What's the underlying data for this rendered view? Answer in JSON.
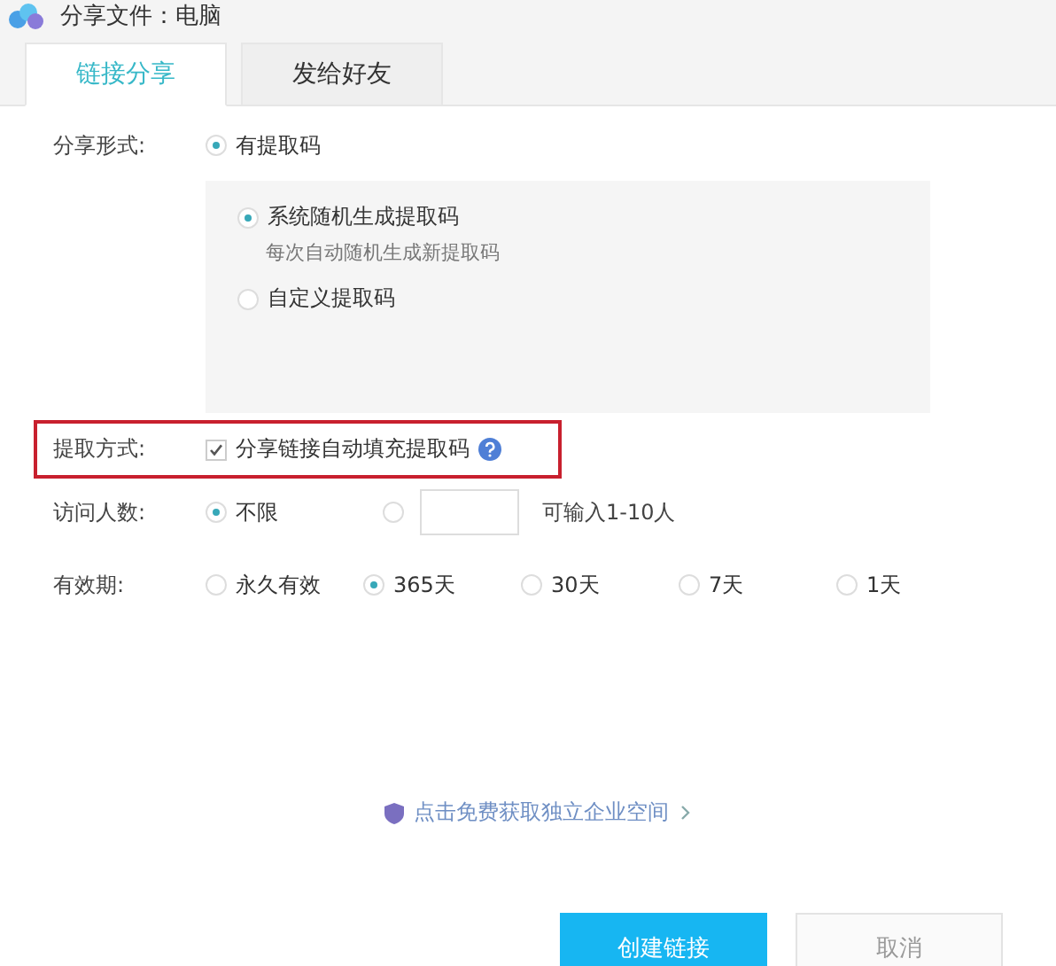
{
  "window": {
    "title": "分享文件：电脑"
  },
  "tabs": [
    {
      "label": "链接分享",
      "selected": true
    },
    {
      "label": "发给好友",
      "selected": false
    }
  ],
  "share_form": {
    "label": "分享形式:",
    "option": {
      "label": "有提取码",
      "selected": true
    },
    "sub_options": [
      {
        "label": "系统随机生成提取码",
        "hint": "每次自动随机生成新提取码",
        "selected": true
      },
      {
        "label": "自定义提取码",
        "selected": false
      }
    ]
  },
  "extract_method": {
    "label": "提取方式:",
    "checkbox": {
      "label": "分享链接自动填充提取码",
      "checked": true
    }
  },
  "visitors": {
    "label": "访问人数:",
    "options": [
      {
        "kind": "label",
        "label": "不限",
        "selected": true
      },
      {
        "kind": "input",
        "selected": false,
        "note": "可输入1-10人"
      }
    ]
  },
  "validity": {
    "label": "有效期:",
    "options": [
      {
        "label": "永久有效",
        "selected": false
      },
      {
        "label": "365天",
        "selected": true
      },
      {
        "label": "30天",
        "selected": false
      },
      {
        "label": "7天",
        "selected": false
      },
      {
        "label": "1天",
        "selected": false
      }
    ]
  },
  "promo_link": "点击免费获取独立企业空间",
  "buttons": [
    {
      "label": "创建链接",
      "kind": "primary"
    },
    {
      "label": "取消",
      "kind": "secondary"
    }
  ]
}
